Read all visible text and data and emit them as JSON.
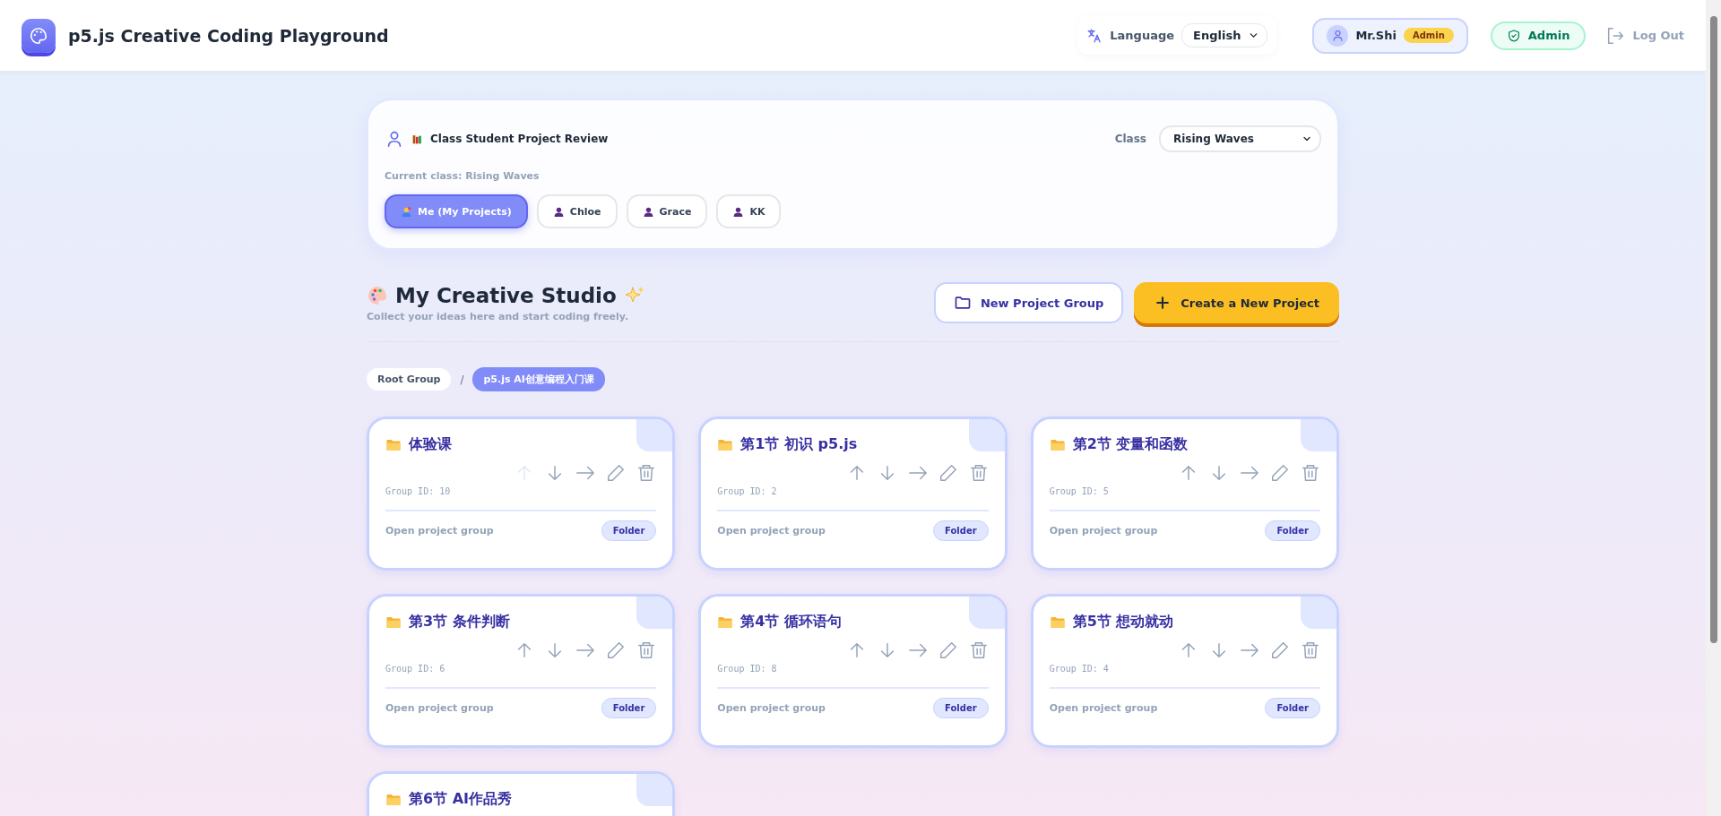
{
  "header": {
    "title": "p5.js Creative Coding Playground",
    "language_label": "Language",
    "language": "English",
    "user_name": "Mr.Shi",
    "user_badge": "Admin",
    "admin_button": "Admin",
    "logout": "Log Out"
  },
  "class_panel": {
    "title": "Class Student Project Review",
    "class_label": "Class",
    "class_value": "Rising Waves",
    "current_class": "Current class: Rising Waves",
    "students": [
      {
        "label": "Me (My Projects)",
        "kind": "self",
        "selected": true
      },
      {
        "label": "Chloe",
        "kind": "student",
        "selected": false
      },
      {
        "label": "Grace",
        "kind": "student",
        "selected": false
      },
      {
        "label": "KK",
        "kind": "student",
        "selected": false
      }
    ]
  },
  "studio": {
    "title": "My Creative Studio",
    "subtitle": "Collect your ideas here and start coding freely.",
    "buttons": [
      {
        "label": "New Project Group",
        "kind": "group"
      },
      {
        "label": "Create a New Project",
        "kind": "create"
      }
    ]
  },
  "breadcrumb": {
    "separator": "/",
    "items": [
      {
        "label": "Root Group",
        "selected": false
      },
      {
        "label": "p5.js AI创意编程入门课",
        "selected": true
      }
    ]
  },
  "groups": [
    {
      "title": "体验课",
      "group_id": "Group ID: 10",
      "footer": "Open project group",
      "badge": "Folder",
      "up_disabled": true
    },
    {
      "title": "第1节 初识 p5.js",
      "group_id": "Group ID: 2",
      "footer": "Open project group",
      "badge": "Folder",
      "up_disabled": false
    },
    {
      "title": "第2节 变量和函数",
      "group_id": "Group ID: 5",
      "footer": "Open project group",
      "badge": "Folder",
      "up_disabled": false
    },
    {
      "title": "第3节 条件判断",
      "group_id": "Group ID: 6",
      "footer": "Open project group",
      "badge": "Folder",
      "up_disabled": false
    },
    {
      "title": "第4节 循环语句",
      "group_id": "Group ID: 8",
      "footer": "Open project group",
      "badge": "Folder",
      "up_disabled": false
    },
    {
      "title": "第5节 想动就动",
      "group_id": "Group ID: 4",
      "footer": "Open project group",
      "badge": "Folder",
      "up_disabled": false
    },
    {
      "title": "第6节 AI作品秀"
    }
  ]
}
